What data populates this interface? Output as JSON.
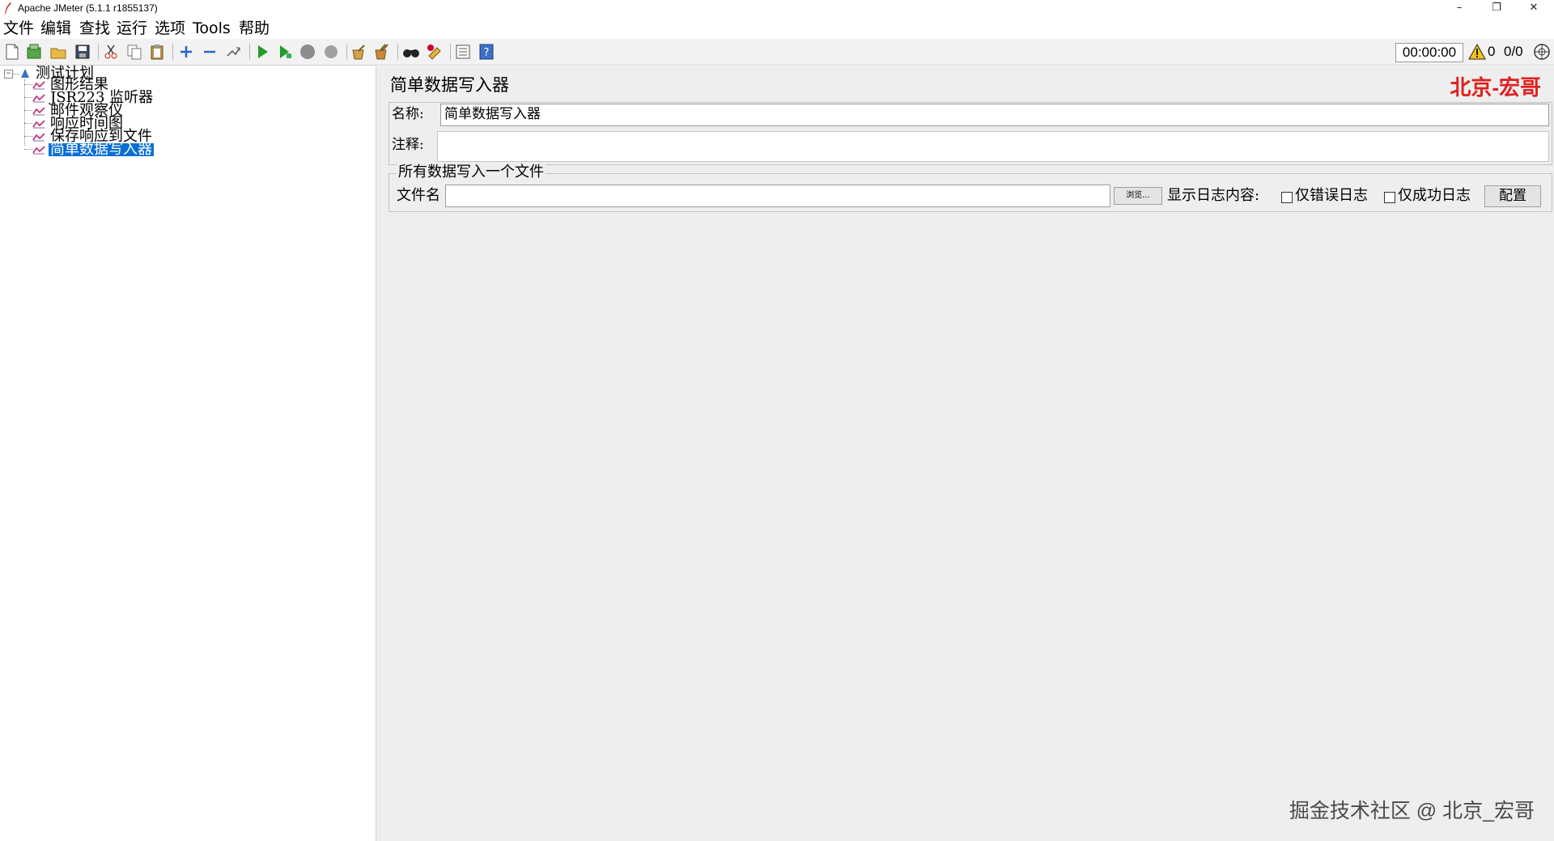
{
  "window": {
    "title": "Apache JMeter (5.1.1 r1855137)",
    "minimize": "–",
    "restore": "❐",
    "close": "✕"
  },
  "menu": [
    "文件",
    "编辑",
    "查找",
    "运行",
    "选项",
    "Tools",
    "帮助"
  ],
  "toolbar": {
    "icons": [
      "new-icon",
      "templates-icon",
      "open-icon",
      "save-icon",
      "cut-icon",
      "copy-icon",
      "paste-icon",
      "expand-icon",
      "collapse-icon",
      "toggle-icon",
      "start-icon",
      "start-no-pause-icon",
      "stop-icon",
      "shutdown-icon",
      "clear-icon",
      "clear-all-icon",
      "search-icon",
      "reset-search-icon",
      "function-helper-icon",
      "help-icon"
    ],
    "timer": "00:00:00",
    "error_count": "0",
    "threads": "0/0"
  },
  "tree": {
    "root": "测试计划",
    "children": [
      "图形结果",
      "JSR223 监听器",
      "邮件观察仪",
      "响应时间图",
      "保存响应到文件",
      "简单数据写入器"
    ],
    "selected_index": 5
  },
  "panel": {
    "title": "简单数据写入器",
    "brand": "北京-宏哥",
    "name_label": "名称:",
    "name_value": "简单数据写入器",
    "comment_label": "注释:",
    "comment_value": "",
    "group_title": "所有数据写入一个文件",
    "filename_label": "文件名",
    "filename_value": "",
    "browse_label": "浏览...",
    "log_label": "显示日志内容:",
    "errors_only_label": "仅错误日志",
    "errors_only_checked": false,
    "success_only_label": "仅成功日志",
    "success_only_checked": false,
    "configure_label": "配置"
  },
  "watermark": "掘金技术社区 @ 北京_宏哥",
  "colors": {
    "selection": "#0a6fd3",
    "brand": "#e02020",
    "panel_bg": "#eeeeee"
  }
}
